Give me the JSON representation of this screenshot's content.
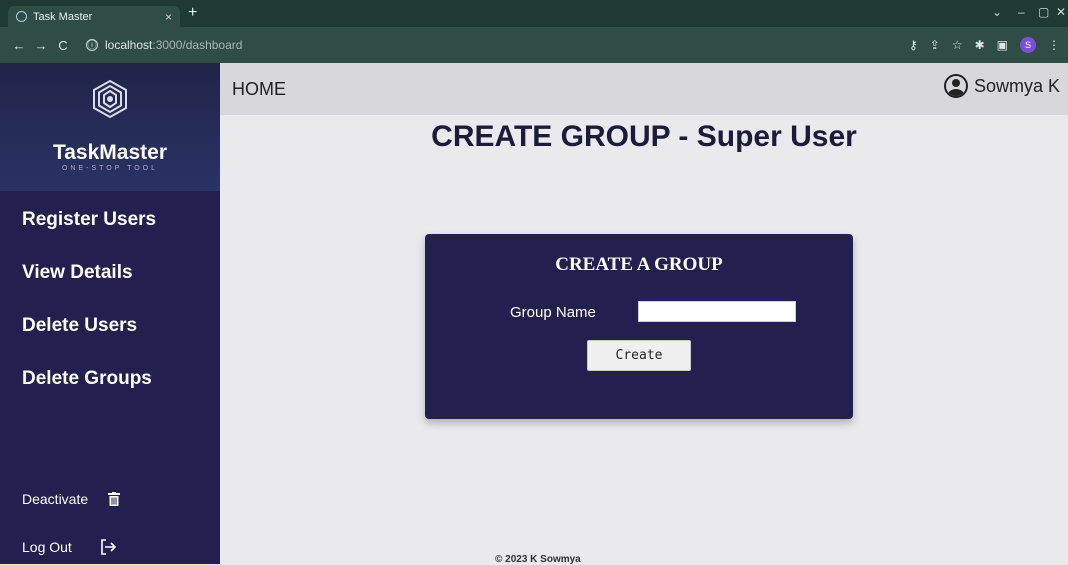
{
  "browser": {
    "tab_title": "Task Master",
    "tab_close": "×",
    "new_tab": "+",
    "url_host": "localhost",
    "url_path": ":3000/dashboard",
    "info_icon": "ⓘ",
    "back": "←",
    "forward": "→",
    "reload": "C",
    "profile_initial": "S"
  },
  "sidebar": {
    "brand_name": "TaskMaster",
    "brand_tagline": "ONE-STOP TOOL",
    "menu": [
      {
        "label": "Register Users"
      },
      {
        "label": "View Details"
      },
      {
        "label": "Delete Users"
      },
      {
        "label": "Delete Groups"
      }
    ],
    "deactivate_label": "Deactivate",
    "logout_label": "Log Out"
  },
  "header": {
    "home_label": "HOME",
    "user_name": "Sowmya K"
  },
  "main": {
    "page_title": "CREATE GROUP - Super User",
    "card_title": "CREATE A GROUP",
    "group_name_label": "Group Name",
    "group_name_value": "",
    "create_label": "Create"
  },
  "footer": {
    "text": "© 2023 K Sowmya"
  },
  "colors": {
    "sidebar_bg": "#23204f",
    "card_bg": "#23204f",
    "header_bg": "#d8d8db",
    "page_bg": "#e9e9ee",
    "browser_bg": "#2f4d45"
  }
}
